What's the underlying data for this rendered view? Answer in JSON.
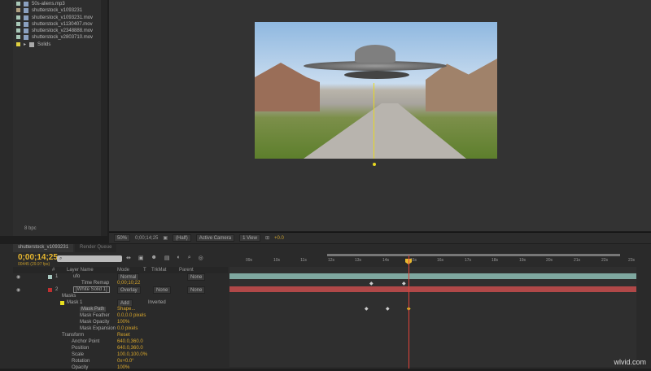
{
  "project": {
    "items": [
      {
        "name": "50s-aliens.mp3",
        "color": "#a8c8b8"
      },
      {
        "name": "shutterstock_v1093231",
        "color": "#b0a080"
      },
      {
        "name": "shutterstock_v1093231.mov",
        "color": "#a8c8b8"
      },
      {
        "name": "shutterstock_v1130407.mov",
        "color": "#a8c8b8"
      },
      {
        "name": "shutterstock_v2348888.mov",
        "color": "#a8c8b8"
      },
      {
        "name": "shutterstock_v2803710.mov",
        "color": "#a8c8b8"
      },
      {
        "name": "Solids",
        "color": "#e0d040"
      }
    ],
    "bpc": "8 bpc"
  },
  "viewer_toolbar": {
    "zoom": "50%",
    "timecode": "0;00;14;25",
    "resolution": "(Half)",
    "camera": "Active Camera",
    "view": "1 View",
    "exposure": "+0.0"
  },
  "timeline": {
    "tabs": [
      "shutterstock_v1093231",
      "Render Queue"
    ],
    "timecode": "0;00;14;25",
    "frames": "00445 (29.97 fps)",
    "search_placeholder": "",
    "columns": {
      "layer_name": "Layer Name",
      "mode": "Mode",
      "t": "T",
      "trkmat": "TrkMat",
      "parent": "Parent",
      "num": "#"
    },
    "ruler": [
      "09s",
      "10s",
      "11s",
      "12s",
      "13s",
      "14s",
      "15s",
      "16s",
      "17s",
      "18s",
      "19s",
      "20s",
      "21s",
      "22s",
      "23s"
    ],
    "rows": [
      {
        "num": "1",
        "name": "ufo",
        "mode": "Normal",
        "trkmat": "",
        "parent": "None",
        "color": "#a8c8c0"
      },
      {
        "name": "Time Remap",
        "value": "0;00;10;22"
      },
      {
        "num": "2",
        "name": "[White Solid 1]",
        "mode": "Overlay",
        "trkmat": "None",
        "parent": "None",
        "color": "#c03030"
      },
      {
        "name": "Masks"
      },
      {
        "name": "Mask 1",
        "mode": "Add",
        "extra": "Inverted"
      },
      {
        "name": "Mask Path",
        "value": "Shape..."
      },
      {
        "name": "Mask Feather",
        "value": "0.0,0.0 pixels"
      },
      {
        "name": "Mask Opacity",
        "value": "100%"
      },
      {
        "name": "Mask Expansion",
        "value": "0.0 pixels"
      },
      {
        "name": "Transform",
        "value": "Reset"
      },
      {
        "name": "Anchor Point",
        "value": "640.0,360.0"
      },
      {
        "name": "Position",
        "value": "640.0,360.0"
      },
      {
        "name": "Scale",
        "value": "100.0,100.0%"
      },
      {
        "name": "Rotation",
        "value": "0x+0.0°"
      },
      {
        "name": "Opacity",
        "value": "100%"
      }
    ]
  },
  "watermark": "wlvid.com"
}
